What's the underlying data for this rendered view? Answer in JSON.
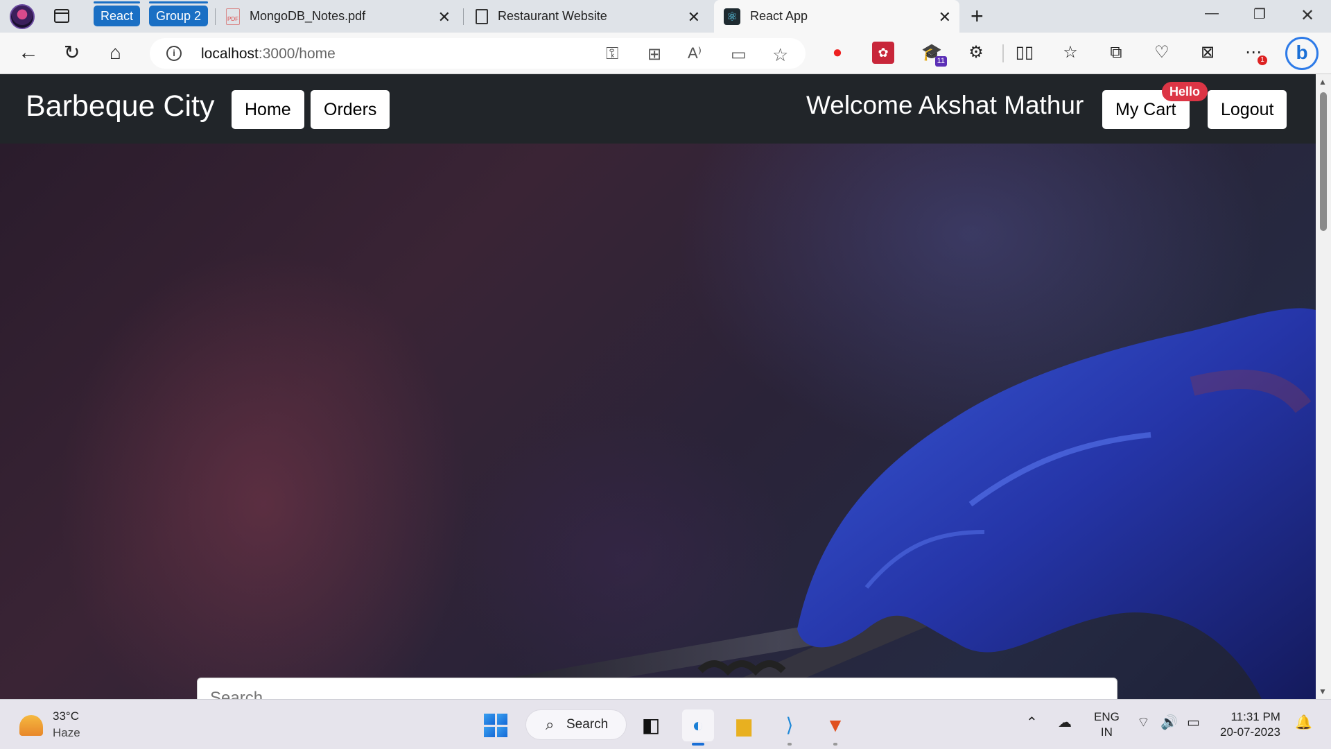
{
  "browser": {
    "tab_groups": [
      {
        "label": "React",
        "color": "#1a6fc4"
      },
      {
        "label": "Group 2",
        "color": "#1a6fc4"
      }
    ],
    "tabs": [
      {
        "title": "MongoDB_Notes.pdf",
        "icon": "pdf-icon",
        "active": false
      },
      {
        "title": "Restaurant Website",
        "icon": "document-icon",
        "active": false
      },
      {
        "title": "React App",
        "icon": "react-icon",
        "active": true
      }
    ],
    "address": {
      "host": "localhost",
      "path": ":3000/home"
    },
    "extensions": [
      {
        "name": "red-extension-icon",
        "badge": ""
      },
      {
        "name": "puzzle-game-extension-icon",
        "badge": ""
      },
      {
        "name": "graduation-cap-extension-icon",
        "badge": "11"
      },
      {
        "name": "extensions-icon",
        "badge": ""
      }
    ],
    "more_badge": "1"
  },
  "site": {
    "brand": "Barbeque City",
    "nav": {
      "home": "Home",
      "orders": "Orders"
    },
    "welcome": "Welcome Akshat Mathur",
    "cart_label": "My Cart",
    "cart_badge": "Hello",
    "logout_label": "Logout",
    "search_placeholder": "Search",
    "badge_color": "#dc3545",
    "navbar_color": "#212529"
  },
  "taskbar": {
    "weather": {
      "temp": "33°C",
      "condition": "Haze"
    },
    "search_label": "Search",
    "language": {
      "line1": "ENG",
      "line2": "IN"
    },
    "clock": {
      "time": "11:31 PM",
      "date": "20-07-2023"
    }
  }
}
